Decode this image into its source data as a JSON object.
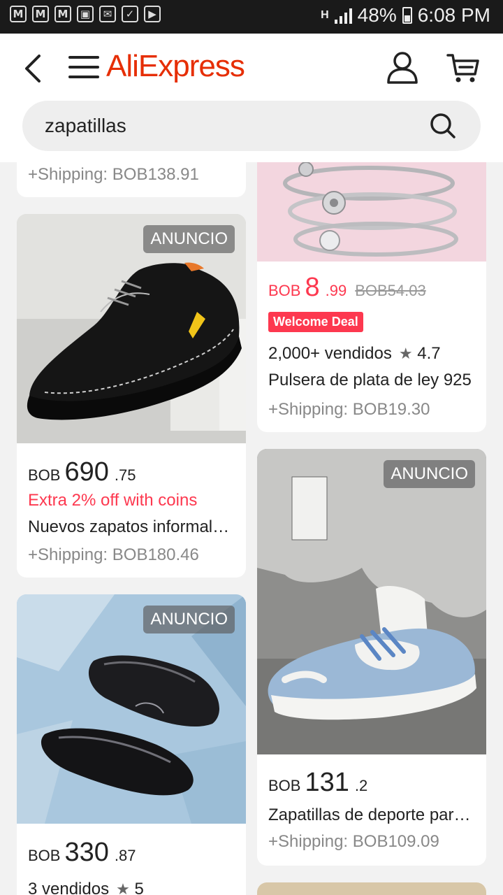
{
  "status_bar": {
    "left_icons": [
      "M",
      "M",
      "M",
      "▣",
      "✉",
      "✓",
      "▶"
    ],
    "network": "H",
    "battery": "48%",
    "time": "6:08 PM"
  },
  "header": {
    "brand": "AliExpress",
    "search_value": "zapatillas"
  },
  "products": [
    {
      "shipping": "+Shipping: BOB138.91"
    },
    {
      "badge": "ANUNCIO",
      "currency": "BOB",
      "price_int": "690",
      "price_dec": ".75",
      "promo": "Extra 2% off with coins",
      "title": "Nuevos zapatos informales de cuero",
      "shipping": "+Shipping: BOB180.46"
    },
    {
      "badge": "ANUNCIO",
      "currency": "BOB",
      "price_int": "330",
      "price_dec": ".87",
      "sold": "3 vendidos",
      "rating": "5"
    },
    {
      "currency": "BOB",
      "price_int": "8",
      "price_dec": ".99",
      "old_price": "BOB54.03",
      "deal": "Welcome Deal",
      "sold": "2,000+ vendidos",
      "rating": "4.7",
      "title": "Pulsera de plata de ley 925",
      "shipping": "+Shipping: BOB19.30"
    },
    {
      "badge": "ANUNCIO",
      "currency": "BOB",
      "price_int": "131",
      "price_dec": ".2",
      "title": "Zapatillas de deporte para mujer",
      "shipping": "+Shipping: BOB109.09"
    }
  ],
  "colors": {
    "brand": "#e62e04",
    "price_red": "#fd384f",
    "deal_bg": "#fd384f"
  }
}
